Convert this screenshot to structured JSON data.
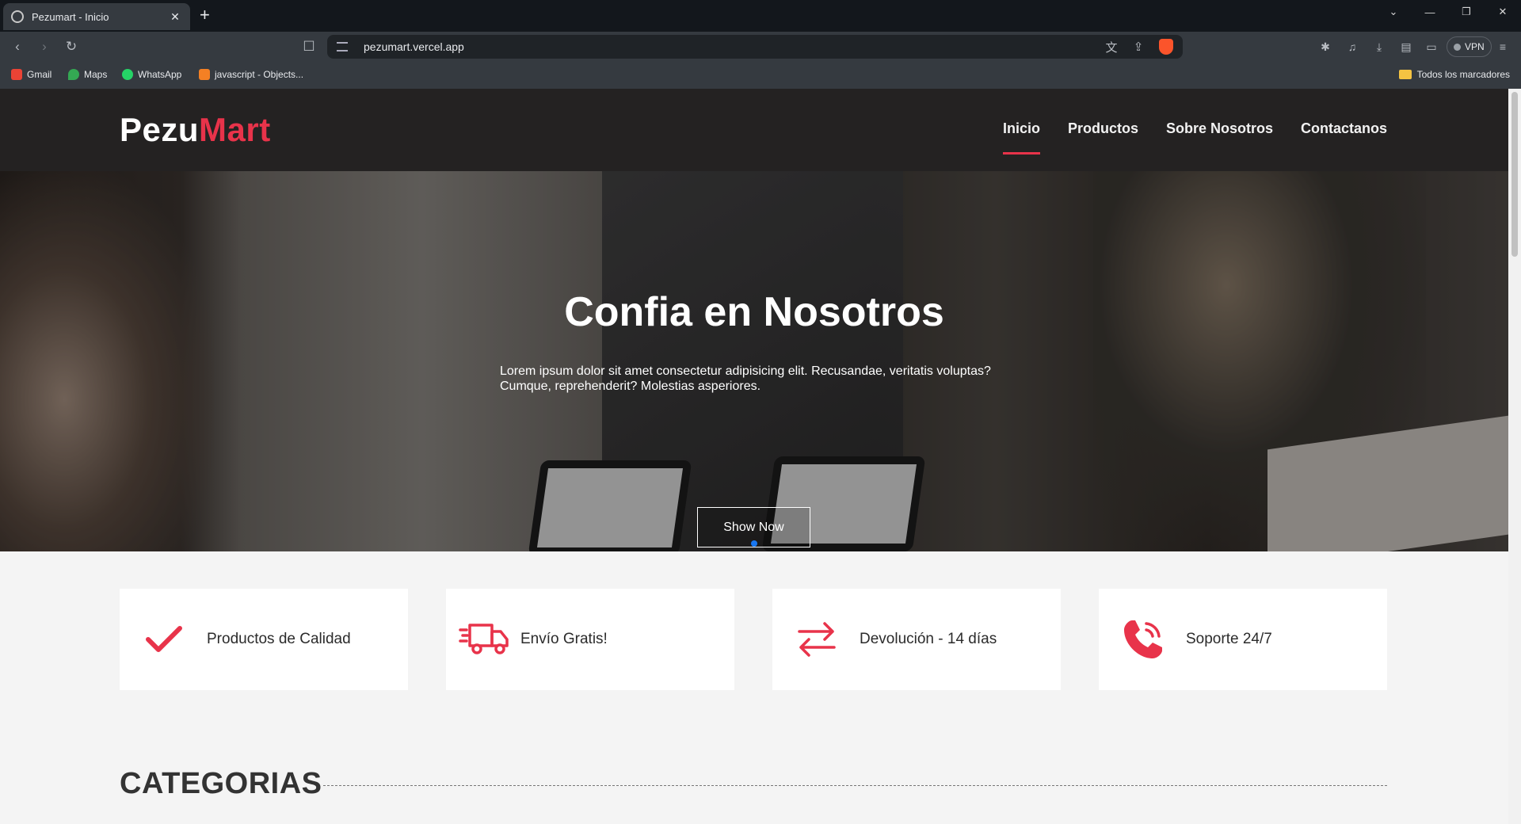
{
  "browser": {
    "tab_title": "Pezumart - Inicio",
    "url": "pezumart.vercel.app",
    "vpn_label": "VPN",
    "bookmarks": [
      {
        "label": "Gmail",
        "color": "#ea4335"
      },
      {
        "label": "Maps",
        "color": "#34a853"
      },
      {
        "label": "WhatsApp",
        "color": "#25d366"
      },
      {
        "label": "javascript - Objects...",
        "color": "#f48024"
      }
    ],
    "bookmarks_folder": "Todos los marcadores"
  },
  "site": {
    "logo_main": "Pezu",
    "logo_accent": "Mart",
    "accent_color": "#e8334a",
    "nav": [
      "Inicio",
      "Productos",
      "Sobre Nosotros",
      "Contactanos"
    ],
    "nav_active": "Inicio"
  },
  "hero": {
    "title": "Confia en Nosotros",
    "text": "Lorem ipsum dolor sit amet consectetur adipisicing elit. Recusandae, veritatis voluptas? Cumque, reprehenderit? Molestias asperiores.",
    "button": "Show Now",
    "slides": 3,
    "active_slide": 1
  },
  "features": [
    {
      "icon": "check-icon",
      "label": "Productos de Calidad"
    },
    {
      "icon": "truck-icon",
      "label": "Envío Gratis!"
    },
    {
      "icon": "exchange-arrows-icon",
      "label": "Devolución - 14 días"
    },
    {
      "icon": "phone-ringing-icon",
      "label": "Soporte 24/7"
    }
  ],
  "categories": {
    "title": "CATEGORIAS"
  }
}
